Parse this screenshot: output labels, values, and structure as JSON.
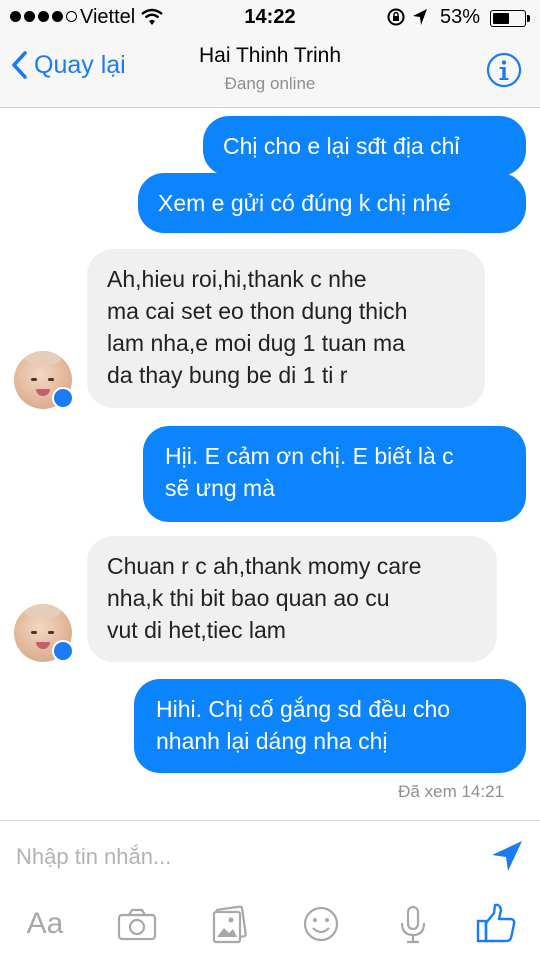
{
  "status_bar": {
    "carrier": "Viettel",
    "time": "14:22",
    "battery_percent": "53%",
    "battery_level": 0.53,
    "signal_bars_filled": 4,
    "signal_bars_total": 5
  },
  "header": {
    "back_label": "Quay lại",
    "contact_name": "Hai Thinh Trinh",
    "contact_status": "Đang online",
    "info_icon": "info-icon",
    "accent_color": "#1a7cf5"
  },
  "messages": [
    {
      "direction": "outgoing",
      "text": "Chị cho e lại sđt địa chỉ"
    },
    {
      "direction": "outgoing",
      "text": "Xem e gửi có đúng k chị nhé"
    },
    {
      "direction": "incoming",
      "text": "Ah,hieu roi,hi,thank c nhe\nma cai set eo thon dung thich\nlam nha,e moi dug 1 tuan ma\nda thay bung be di 1 ti r"
    },
    {
      "direction": "outgoing",
      "text": "Hịi. E cảm ơn chị. E biết là c\nsẽ ưng mà"
    },
    {
      "direction": "incoming",
      "text": "Chuan r c ah,thank momy care\nnha,k thi bit bao quan ao cu\nvut di het,tiec lam"
    },
    {
      "direction": "outgoing",
      "text": "Hihi. Chị cố gắng sd đều cho\nnhanh lại dáng nha chị"
    }
  ],
  "seen_receipt": "Đã xem 14:21",
  "composer": {
    "placeholder": "Nhập tin nhắn...",
    "value": "",
    "aa_label": "Aa",
    "tools": [
      "text-format-icon",
      "camera-icon",
      "photo-icon",
      "emoji-icon",
      "microphone-icon",
      "like-icon"
    ]
  },
  "colors": {
    "outgoing_bubble": "#0b84fe",
    "incoming_bubble": "#f1f0f0",
    "bar_background": "#f7f7f7"
  }
}
